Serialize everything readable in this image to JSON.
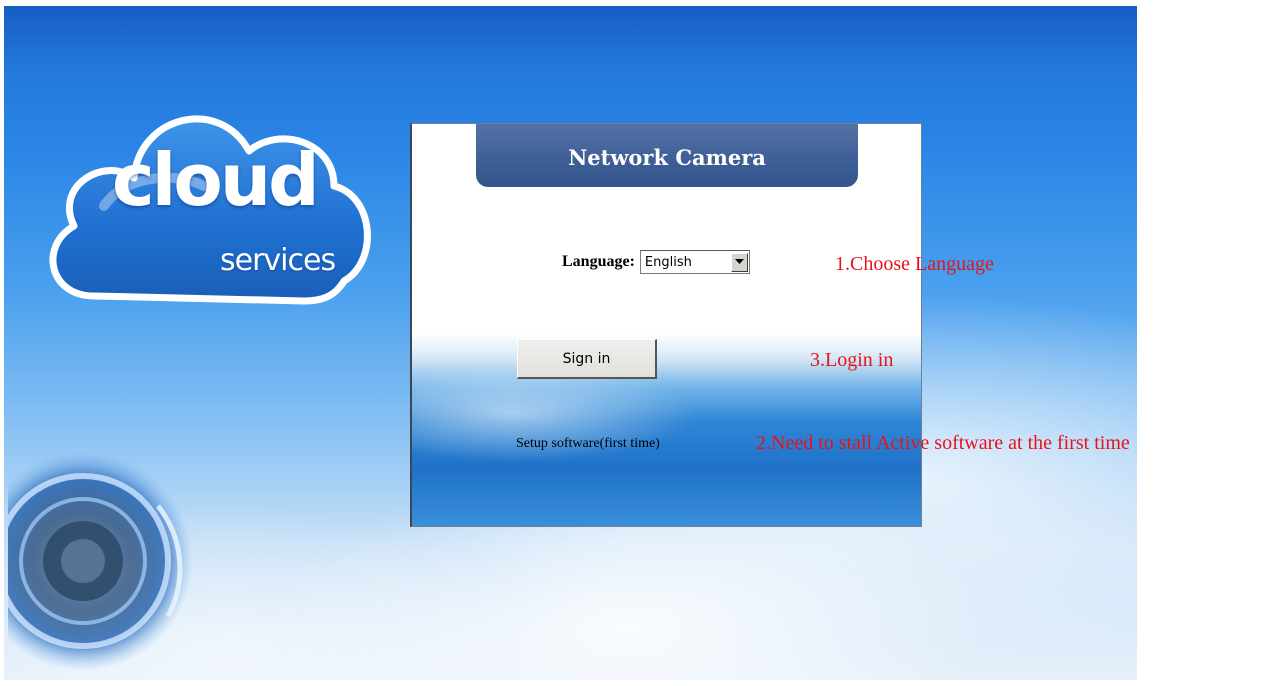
{
  "branding": {
    "cloud_word": "cloud",
    "services_word": "services"
  },
  "panel": {
    "title": "Network Camera",
    "language_label": "Language:",
    "language_selected": "English",
    "signin_label": "Sign in",
    "setup_link_label": "Setup software(first time)"
  },
  "annotations": {
    "step1": "1.Choose Language",
    "step3": "3.Login in",
    "step2": "2.Need to stall Active software at the first time"
  },
  "colors": {
    "annotation_red": "#e8121a",
    "header_blue": "#3f5f97",
    "background_blue": "#2b86e6"
  },
  "icons": {
    "dropdown": "chevron-down-icon",
    "logo": "cloud-logo-icon",
    "lens": "camera-lens-icon"
  }
}
